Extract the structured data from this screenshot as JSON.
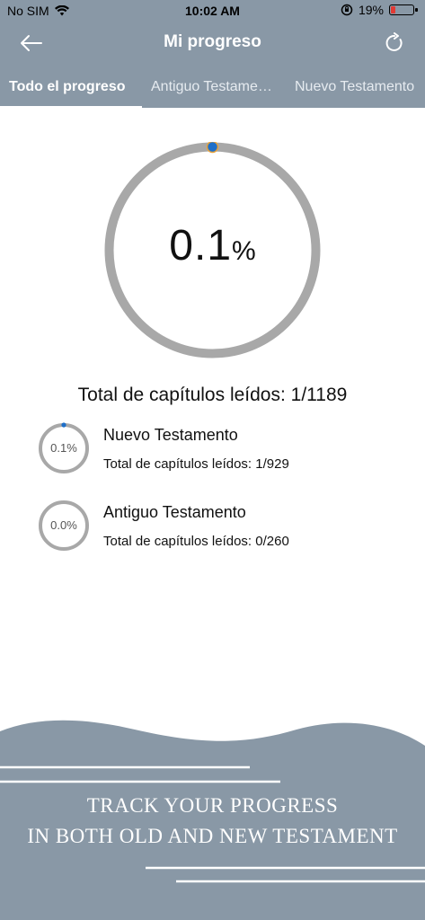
{
  "status_bar": {
    "carrier": "No SIM",
    "time": "10:02 AM",
    "battery": "19%",
    "battery_level": 0.19,
    "accent_low": "#e23a34"
  },
  "nav": {
    "title": "Mi progreso",
    "back_icon": "arrow-left-icon",
    "refresh_icon": "refresh-icon"
  },
  "tabs": [
    {
      "label": "Todo el progreso",
      "active": true
    },
    {
      "label": "Antiguo Testamento",
      "active": false
    },
    {
      "label": "Nuevo Testamento",
      "active": false
    }
  ],
  "overall": {
    "percent": "0.1",
    "percent_sign": "%",
    "fraction": 0.001,
    "total_label": "Total de capítulos leídos: 1/1189"
  },
  "items": [
    {
      "name": "Nuevo Testamento",
      "subtitle": "Total de capítulos leídos: 1/929",
      "percent_label": "0.1%",
      "fraction": 0.001
    },
    {
      "name": "Antiguo Testamento",
      "subtitle": "Total de capítulos leídos: 0/260",
      "percent_label": "0.0%",
      "fraction": 0
    }
  ],
  "banner": {
    "line1": "TRACK YOUR PROGRESS",
    "line2": "IN BOTH OLD AND NEW TESTAMENT"
  },
  "colors": {
    "header_bg": "#8998a6",
    "ring_track": "#a8a8a8",
    "ring_progress": "#1e6fc9",
    "ring_progress_outline": "#e7a23b"
  }
}
